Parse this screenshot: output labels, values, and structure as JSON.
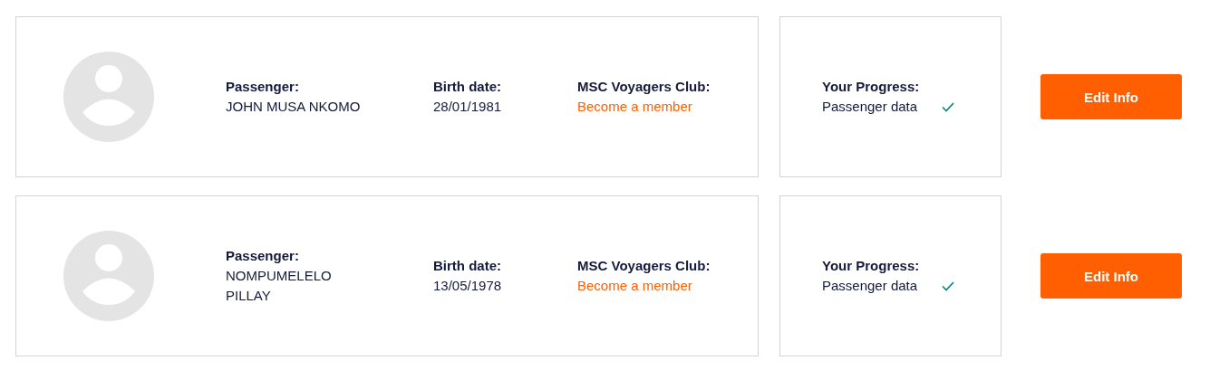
{
  "passengers": [
    {
      "passenger_label": "Passenger:",
      "name_lines": [
        "JOHN MUSA NKOMO"
      ],
      "birth_label": "Birth date:",
      "birth_date": "28/01/1981",
      "club_label": "MSC Voyagers Club:",
      "club_link": "Become a member",
      "progress_label": "Your Progress:",
      "progress_item": "Passenger data",
      "progress_done": true,
      "button": "Edit Info"
    },
    {
      "passenger_label": "Passenger:",
      "name_lines": [
        "NOMPUMELELO",
        "PILLAY"
      ],
      "birth_label": "Birth date:",
      "birth_date": "13/05/1978",
      "club_label": "MSC Voyagers Club:",
      "club_link": "Become a member",
      "progress_label": "Your Progress:",
      "progress_item": "Passenger data",
      "progress_done": true,
      "button": "Edit Info"
    }
  ]
}
